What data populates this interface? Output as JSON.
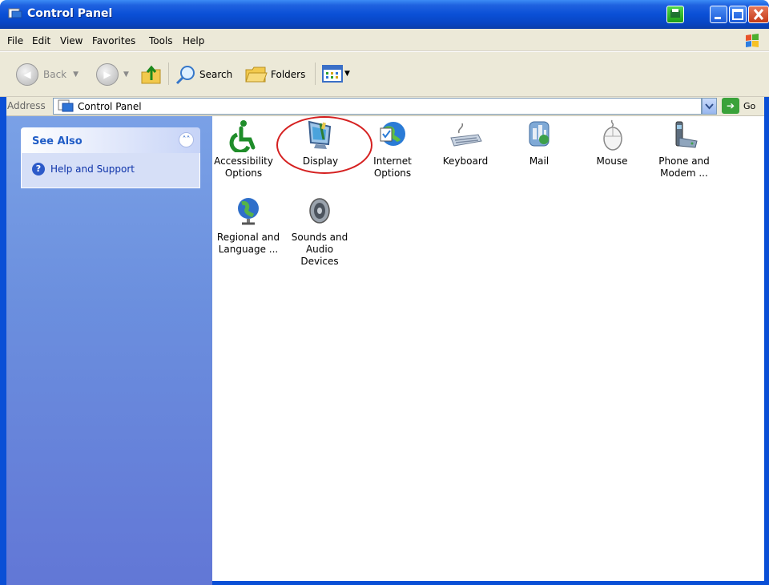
{
  "window": {
    "title": "Control Panel"
  },
  "menu": [
    "File",
    "Edit",
    "View",
    "Favorites",
    "Tools",
    "Help"
  ],
  "toolbar": {
    "back": "Back",
    "search": "Search",
    "folders": "Folders"
  },
  "address": {
    "label": "Address",
    "value": "Control Panel",
    "go": "Go"
  },
  "taskpane": {
    "title": "See Also",
    "links": [
      "Help and Support"
    ]
  },
  "items": [
    {
      "line1": "Accessibility",
      "line2": "Options",
      "icon": "accessibility-icon"
    },
    {
      "line1": "Display",
      "line2": "",
      "icon": "display-icon"
    },
    {
      "line1": "Internet",
      "line2": "Options",
      "icon": "internet-options-icon"
    },
    {
      "line1": "Keyboard",
      "line2": "",
      "icon": "keyboard-icon"
    },
    {
      "line1": "Mail",
      "line2": "",
      "icon": "mail-icon"
    },
    {
      "line1": "Mouse",
      "line2": "",
      "icon": "mouse-icon"
    },
    {
      "line1": "Phone and",
      "line2": "Modem ...",
      "icon": "phone-modem-icon"
    },
    {
      "line1": "Regional and",
      "line2": "Language ...",
      "icon": "globe-icon"
    },
    {
      "line1": "Sounds and",
      "line2": "Audio Devices",
      "icon": "speaker-icon"
    }
  ],
  "highlight": "Display"
}
